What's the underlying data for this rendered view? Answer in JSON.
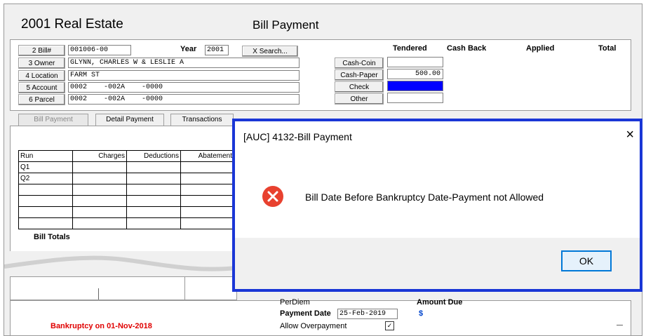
{
  "app": {
    "title_left": "2001 Real Estate",
    "title_center": "Bill Payment"
  },
  "lookup": {
    "bill_button": "2 Bill#",
    "bill_value": "001006-00",
    "year_label": "Year",
    "year_value": "2001",
    "search_button": "X Search...",
    "owner_button": "3 Owner",
    "owner_value": "GLYNN, CHARLES W & LESLIE A",
    "location_button": "4 Location",
    "location_value": "FARM ST",
    "account_button": "5 Account",
    "account_value": "0002    -002A    -0000",
    "parcel_button": "6 Parcel",
    "parcel_value": "0002    -002A    -0000"
  },
  "tender": {
    "headers": [
      "Tendered",
      "Cash Back",
      "Applied",
      "Total"
    ],
    "rows": [
      {
        "label": "Cash-Coin",
        "value": ""
      },
      {
        "label": "Cash-Paper",
        "value": "500.00"
      },
      {
        "label": "Check",
        "value": ""
      },
      {
        "label": "Other",
        "value": ""
      }
    ]
  },
  "tabs": [
    "Bill Payment",
    "Detail Payment",
    "Transactions"
  ],
  "grid": {
    "headers": [
      "Run",
      "Charges",
      "Deductions",
      "Abatements"
    ],
    "rows": [
      [
        "Q1",
        "",
        "",
        ""
      ],
      [
        "Q2",
        "",
        "",
        ""
      ],
      [
        "",
        "",
        "",
        ""
      ],
      [
        "",
        "",
        "",
        ""
      ],
      [
        "",
        "",
        "",
        ""
      ],
      [
        "",
        "",
        "",
        ""
      ]
    ],
    "totals_label": "Bill Totals"
  },
  "bottom": {
    "per_diem_label": "PerDiem",
    "payment_date_label": "Payment Date",
    "payment_date_value": "25-Feb-2019",
    "allow_overpayment_label": "Allow Overpayment",
    "amount_due_label": "Amount Due",
    "amount_due_value": "$",
    "bankruptcy_text": "Bankruptcy on 01-Nov-2018"
  },
  "dialog": {
    "title": "[AUC] 4132-Bill Payment",
    "message": "Bill Date Before Bankruptcy Date-Payment not Allowed",
    "ok_button": "OK",
    "close_glyph": "×"
  },
  "colors": {
    "dialog_border": "#1a36d6",
    "error_icon": "#e8412f",
    "bankruptcy_text": "#e00000",
    "check_field": "#0000ff",
    "amount_due_color": "#0044cc"
  }
}
